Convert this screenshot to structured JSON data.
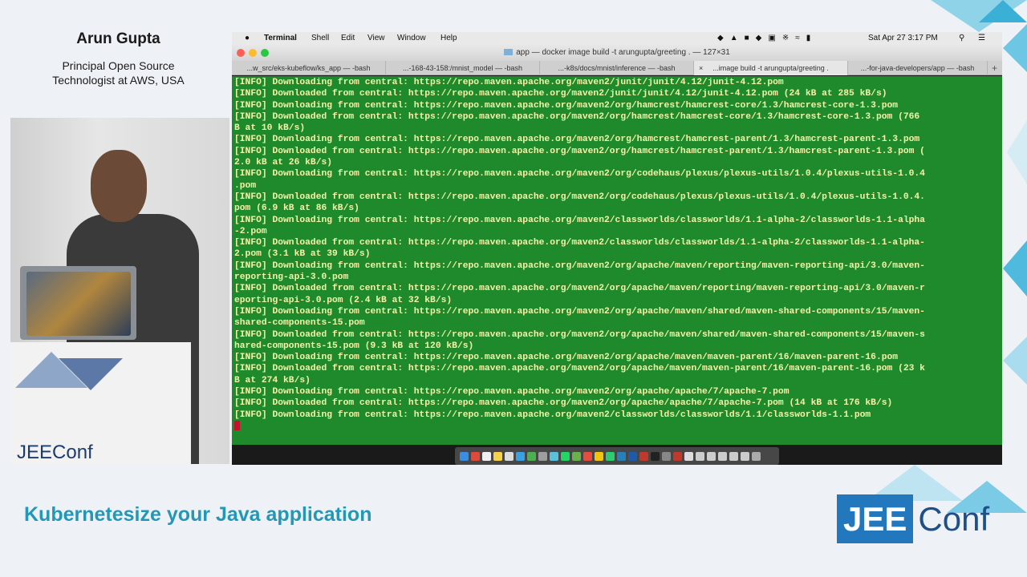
{
  "speaker": {
    "name": "Arun Gupta",
    "title": "Principal Open Source\nTechnologist at AWS, USA"
  },
  "talk": {
    "title": "Kubernetesize your Java application"
  },
  "brand": {
    "part1": "JEE",
    "part2": "Conf"
  },
  "camera": {
    "logo_part1": "JEE",
    "logo_part2": "Conf"
  },
  "menubar": {
    "apple_icon": "apple-icon",
    "app": "Terminal",
    "items": [
      "Shell",
      "Edit",
      "View",
      "Window",
      "Help"
    ],
    "datetime": "Sat Apr 27  3:17 PM"
  },
  "window": {
    "title": "app — docker image build -t arungupta/greeting . — 127×31"
  },
  "tabs": [
    {
      "label": "...w_src/eks-kubeflow/ks_app — -bash"
    },
    {
      "label": "...-168-43-158:/mnist_model — -bash"
    },
    {
      "label": "...-k8s/docs/mnist/inference — -bash"
    },
    {
      "label": "...image build -t arungupta/greeting ."
    },
    {
      "label": "...-for-java-developers/app — -bash"
    }
  ],
  "terminal": {
    "lines": [
      "[INFO] Downloading from central: https://repo.maven.apache.org/maven2/junit/junit/4.12/junit-4.12.pom",
      "[INFO] Downloaded from central: https://repo.maven.apache.org/maven2/junit/junit/4.12/junit-4.12.pom (24 kB at 285 kB/s)",
      "[INFO] Downloading from central: https://repo.maven.apache.org/maven2/org/hamcrest/hamcrest-core/1.3/hamcrest-core-1.3.pom",
      "[INFO] Downloaded from central: https://repo.maven.apache.org/maven2/org/hamcrest/hamcrest-core/1.3/hamcrest-core-1.3.pom (766",
      "B at 10 kB/s)",
      "[INFO] Downloading from central: https://repo.maven.apache.org/maven2/org/hamcrest/hamcrest-parent/1.3/hamcrest-parent-1.3.pom",
      "[INFO] Downloaded from central: https://repo.maven.apache.org/maven2/org/hamcrest/hamcrest-parent/1.3/hamcrest-parent-1.3.pom (",
      "2.0 kB at 26 kB/s)",
      "[INFO] Downloading from central: https://repo.maven.apache.org/maven2/org/codehaus/plexus/plexus-utils/1.0.4/plexus-utils-1.0.4",
      ".pom",
      "[INFO] Downloaded from central: https://repo.maven.apache.org/maven2/org/codehaus/plexus/plexus-utils/1.0.4/plexus-utils-1.0.4.",
      "pom (6.9 kB at 86 kB/s)",
      "[INFO] Downloading from central: https://repo.maven.apache.org/maven2/classworlds/classworlds/1.1-alpha-2/classworlds-1.1-alpha",
      "-2.pom",
      "[INFO] Downloaded from central: https://repo.maven.apache.org/maven2/classworlds/classworlds/1.1-alpha-2/classworlds-1.1-alpha-",
      "2.pom (3.1 kB at 39 kB/s)",
      "[INFO] Downloading from central: https://repo.maven.apache.org/maven2/org/apache/maven/reporting/maven-reporting-api/3.0/maven-",
      "reporting-api-3.0.pom",
      "[INFO] Downloaded from central: https://repo.maven.apache.org/maven2/org/apache/maven/reporting/maven-reporting-api/3.0/maven-r",
      "eporting-api-3.0.pom (2.4 kB at 32 kB/s)",
      "[INFO] Downloading from central: https://repo.maven.apache.org/maven2/org/apache/maven/shared/maven-shared-components/15/maven-",
      "shared-components-15.pom",
      "[INFO] Downloaded from central: https://repo.maven.apache.org/maven2/org/apache/maven/shared/maven-shared-components/15/maven-s",
      "hared-components-15.pom (9.3 kB at 120 kB/s)",
      "[INFO] Downloading from central: https://repo.maven.apache.org/maven2/org/apache/maven/maven-parent/16/maven-parent-16.pom",
      "[INFO] Downloaded from central: https://repo.maven.apache.org/maven2/org/apache/maven/maven-parent/16/maven-parent-16.pom (23 k",
      "B at 274 kB/s)",
      "[INFO] Downloading from central: https://repo.maven.apache.org/maven2/org/apache/apache/7/apache-7.pom",
      "[INFO] Downloaded from central: https://repo.maven.apache.org/maven2/org/apache/apache/7/apache-7.pom (14 kB at 176 kB/s)",
      "[INFO] Downloading from central: https://repo.maven.apache.org/maven2/classworlds/classworlds/1.1/classworlds-1.1.pom"
    ]
  },
  "colors": {
    "terminal_bg": "#1f8a2b",
    "terminal_fg": "#f4f4a8",
    "accent": "#2398b6",
    "brand_blue": "#2378bd"
  }
}
